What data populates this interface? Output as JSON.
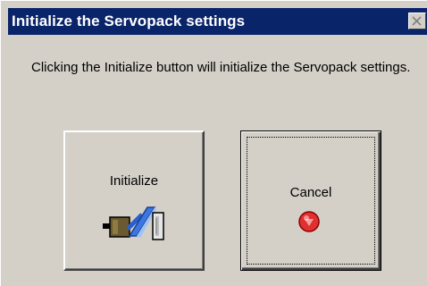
{
  "window": {
    "title": "Initialize the Servopack settings"
  },
  "message": {
    "text": "Clicking the Initialize button will initialize the Servopack settings."
  },
  "buttons": {
    "initialize_label": "Initialize",
    "cancel_label": "Cancel"
  },
  "icons": {
    "close": "close-icon",
    "initialize": "servo-motor-icon",
    "cancel": "stop-sign-icon"
  },
  "colors": {
    "titlebar": "#0a246a",
    "dialog_face": "#d4d0c8",
    "stop_red": "#e03030"
  }
}
